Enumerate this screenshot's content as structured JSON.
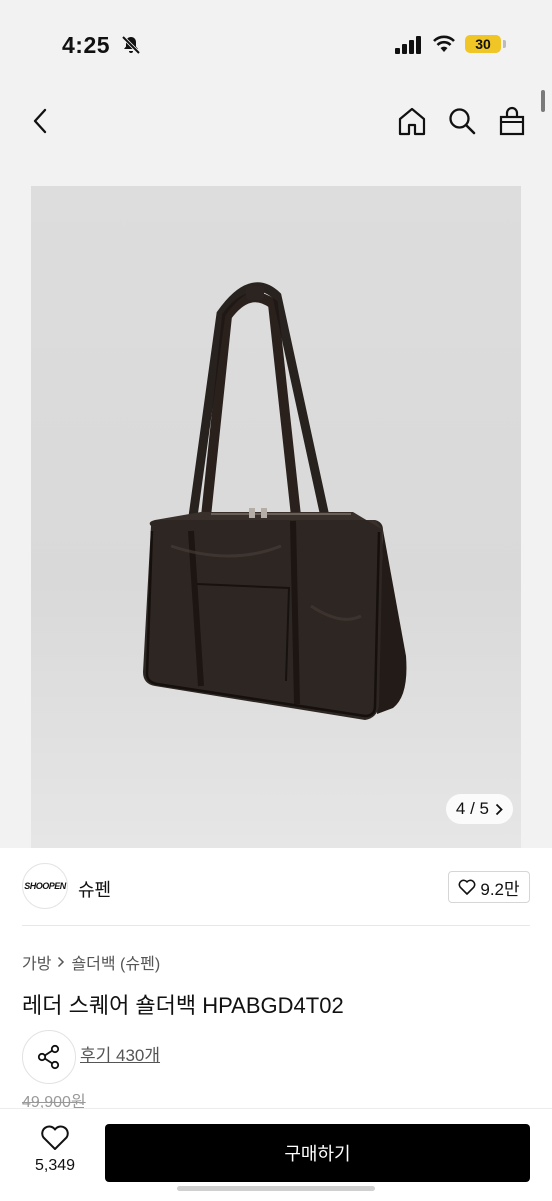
{
  "status_bar": {
    "time": "4:25",
    "battery": "30"
  },
  "product": {
    "image_counter": "4 / 5",
    "brand": "슈펜",
    "brand_logo_text": "SHOOPEN",
    "likes": "9.2만",
    "breadcrumb": [
      "가방",
      "숄더백 (슈펜)"
    ],
    "title": "레더 스퀘어 숄더백 HPABGD4T02",
    "reviews": "후기 430개",
    "original_price": "49,900원"
  },
  "bottom_bar": {
    "favorite_count": "5,349",
    "buy_label": "구매하기"
  }
}
